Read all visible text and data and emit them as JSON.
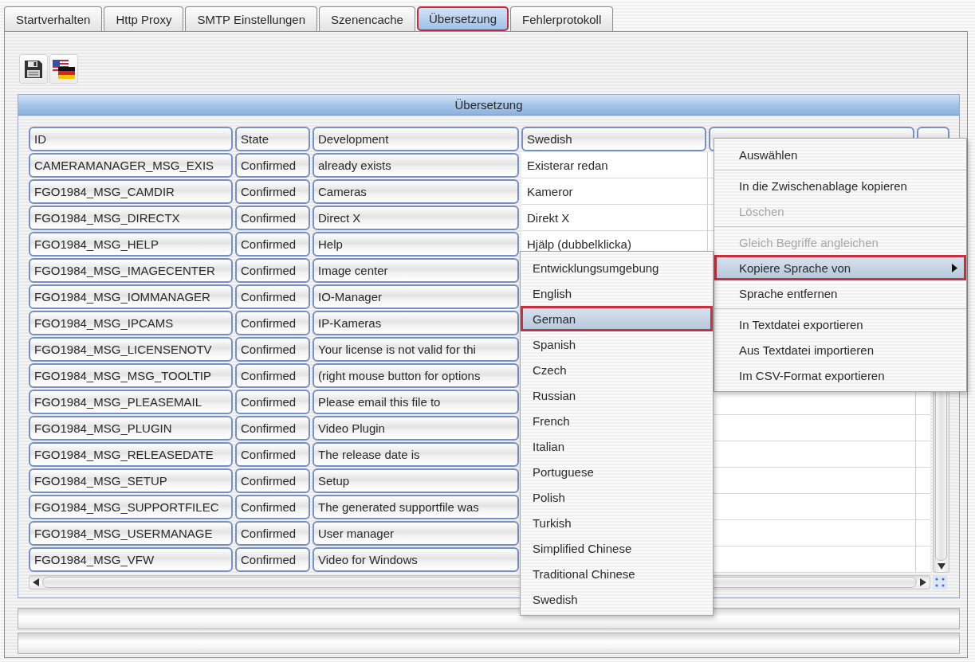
{
  "tabs": [
    {
      "label": "Startverhalten",
      "selected": false
    },
    {
      "label": "Http Proxy",
      "selected": false
    },
    {
      "label": "SMTP Einstellungen",
      "selected": false
    },
    {
      "label": "Szenencache",
      "selected": false
    },
    {
      "label": "Übersetzung",
      "selected": true
    },
    {
      "label": "Fehlerprotokoll",
      "selected": false
    }
  ],
  "panel": {
    "title": "Übersetzung",
    "table": {
      "columns": [
        {
          "label": "ID",
          "editable": false
        },
        {
          "label": "State",
          "editable": false
        },
        {
          "label": "Development",
          "editable": false
        },
        {
          "label": "Swedish",
          "editable": true
        }
      ],
      "rows": [
        [
          "CAMERAMANAGER_MSG_EXIS",
          "Confirmed",
          "already exists",
          "Existerar redan"
        ],
        [
          "FGO1984_MSG_CAMDIR",
          "Confirmed",
          "Cameras",
          "Kameror"
        ],
        [
          "FGO1984_MSG_DIRECTX",
          "Confirmed",
          "Direct X",
          "Direkt X"
        ],
        [
          "FGO1984_MSG_HELP",
          "Confirmed",
          "Help",
          "Hjälp (dubbelklicka)"
        ],
        [
          "FGO1984_MSG_IMAGECENTER",
          "Confirmed",
          "Image center"
        ],
        [
          "FGO1984_MSG_IOMMANAGER",
          "Confirmed",
          "IO-Manager"
        ],
        [
          "FGO1984_MSG_IPCAMS",
          "Confirmed",
          "IP-Kameras"
        ],
        [
          "FGO1984_MSG_LICENSENOTV",
          "Confirmed",
          "Your license is not valid for thi"
        ],
        [
          "FGO1984_MSG_MSG_TOOLTIP",
          "Confirmed",
          "(right mouse button for options"
        ],
        [
          "FGO1984_MSG_PLEASEMAIL",
          "Confirmed",
          "Please email this file to"
        ],
        [
          "FGO1984_MSG_PLUGIN",
          "Confirmed",
          "Video Plugin"
        ],
        [
          "FGO1984_MSG_RELEASEDATE",
          "Confirmed",
          "The release date is"
        ],
        [
          "FGO1984_MSG_SETUP",
          "Confirmed",
          "Setup"
        ],
        [
          "FGO1984_MSG_SUPPORTFILEC",
          "Confirmed",
          "The generated supportfile was"
        ],
        [
          "FGO1984_MSG_USERMANAGE",
          "Confirmed",
          "User manager"
        ],
        [
          "FGO1984_MSG_VFW",
          "Confirmed",
          "Video for Windows"
        ]
      ]
    }
  },
  "context_menu": {
    "items": [
      {
        "kind": "item",
        "label": "Auswählen",
        "disabled": false,
        "selected": false,
        "has_submenu": false
      },
      {
        "kind": "separator"
      },
      {
        "kind": "item",
        "label": "In die Zwischenablage kopieren",
        "disabled": false,
        "selected": false,
        "has_submenu": false
      },
      {
        "kind": "item",
        "label": "Löschen",
        "disabled": true,
        "selected": false,
        "has_submenu": false
      },
      {
        "kind": "separator"
      },
      {
        "kind": "item",
        "label": "Gleich Begriffe angleichen",
        "disabled": true,
        "selected": false,
        "has_submenu": false
      },
      {
        "kind": "item",
        "label": "Kopiere Sprache von",
        "disabled": false,
        "selected": true,
        "has_submenu": true
      },
      {
        "kind": "item",
        "label": "Sprache entfernen",
        "disabled": false,
        "selected": false,
        "has_submenu": false
      },
      {
        "kind": "separator"
      },
      {
        "kind": "item",
        "label": "In Textdatei exportieren",
        "disabled": false,
        "selected": false,
        "has_submenu": false
      },
      {
        "kind": "item",
        "label": "Aus Textdatei importieren",
        "disabled": false,
        "selected": false,
        "has_submenu": false
      },
      {
        "kind": "item",
        "label": "Im CSV-Format exportieren",
        "disabled": false,
        "selected": false,
        "has_submenu": false
      }
    ]
  },
  "submenu": {
    "items": [
      {
        "label": "Entwicklungsumgebung",
        "selected": false
      },
      {
        "label": "English",
        "selected": false
      },
      {
        "label": "German",
        "selected": true
      },
      {
        "label": "Spanish",
        "selected": false
      },
      {
        "label": "Czech",
        "selected": false
      },
      {
        "label": "Russian",
        "selected": false
      },
      {
        "label": "French",
        "selected": false
      },
      {
        "label": "Italian",
        "selected": false
      },
      {
        "label": "Portuguese",
        "selected": false
      },
      {
        "label": "Polish",
        "selected": false
      },
      {
        "label": "Turkish",
        "selected": false
      },
      {
        "label": "Simplified Chinese",
        "selected": false
      },
      {
        "label": "Traditional Chinese",
        "selected": false
      },
      {
        "label": "Swedish",
        "selected": false
      }
    ]
  }
}
